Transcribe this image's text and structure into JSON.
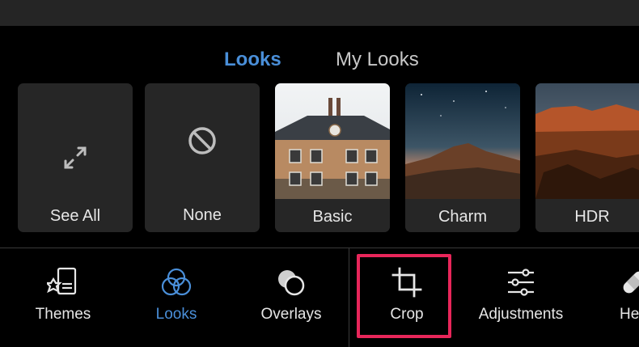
{
  "tabs": {
    "active": "Looks",
    "other": "My Looks"
  },
  "looks": [
    {
      "label": "See All",
      "icon": "expand-icon"
    },
    {
      "label": "None",
      "icon": "prohibited-icon"
    },
    {
      "label": "Basic",
      "icon": "house-photo"
    },
    {
      "label": "Charm",
      "icon": "mountain-photo"
    },
    {
      "label": "HDR",
      "icon": "canyon-photo"
    }
  ],
  "toolbar": {
    "themes": "Themes",
    "looks": "Looks",
    "overlays": "Overlays",
    "crop": "Crop",
    "adjustments": "Adjustments",
    "heal": "He"
  },
  "colors": {
    "accent": "#4a8fd9",
    "highlight": "#e8265a",
    "background": "#000000",
    "card": "#262626"
  }
}
